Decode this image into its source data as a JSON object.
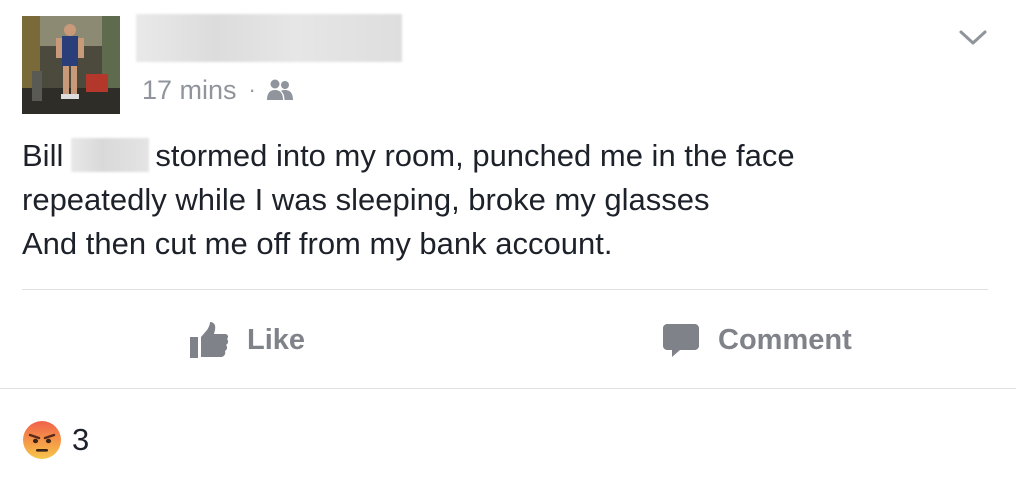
{
  "post": {
    "author_name": "",
    "timestamp": "17 mins",
    "separator": "·",
    "audience_icon": "friends-icon",
    "text": {
      "before_name": "Bill",
      "line1_rest": "stormed into my room, punched me in the face",
      "line2": "repeatedly while I was sleeping, broke my glasses",
      "line3": "And then cut me off from my bank account."
    }
  },
  "actions": {
    "like_label": "Like",
    "comment_label": "Comment"
  },
  "reactions": {
    "icon": "angry-reaction-icon",
    "count": "3"
  },
  "colors": {
    "text": "#1d2129",
    "meta": "#90949c",
    "action": "#7f8389",
    "divider": "#dddfe2",
    "angry_top": "#f0614c",
    "angry_bottom": "#f7c64a"
  }
}
